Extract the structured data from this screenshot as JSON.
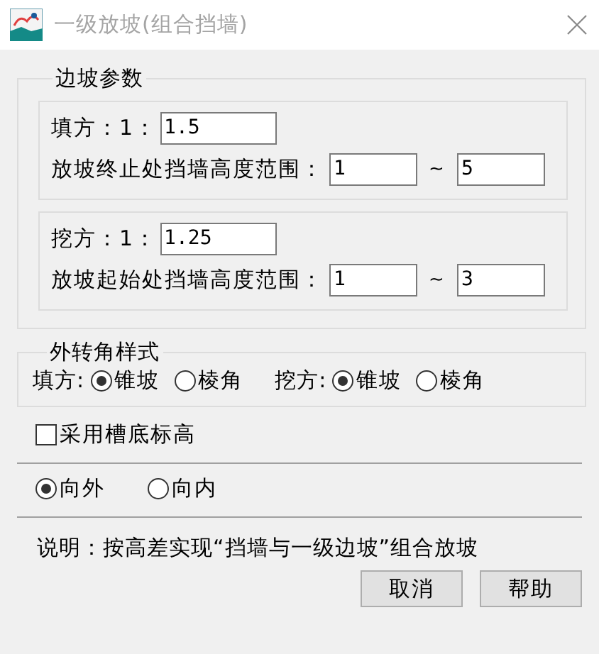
{
  "window": {
    "title": "一级放坡(组合挡墙)"
  },
  "slope_params": {
    "title": "边坡参数",
    "sections": [
      {
        "ratio_label": "填方：1：",
        "ratio": "1.5",
        "range_label": "放坡终止处挡墙高度范围：",
        "range_from": "1",
        "separator": "~",
        "range_to": "5"
      },
      {
        "ratio_label": "挖方：1：",
        "ratio": "1.25",
        "range_label": "放坡起始处挡墙高度范围：",
        "range_from": "1",
        "separator": "~",
        "range_to": "3"
      }
    ]
  },
  "corner_style": {
    "title": "外转角样式",
    "groups": [
      {
        "label": "填方:",
        "options": [
          {
            "label": "锥坡",
            "selected": true
          },
          {
            "label": "棱角",
            "selected": false
          }
        ]
      },
      {
        "label": "挖方:",
        "options": [
          {
            "label": "锥坡",
            "selected": true
          },
          {
            "label": "棱角",
            "selected": false
          }
        ]
      }
    ]
  },
  "trench_bottom": {
    "label": "采用槽底标高",
    "checked": false
  },
  "direction": {
    "options": [
      {
        "label": "向外",
        "selected": true
      },
      {
        "label": "向内",
        "selected": false
      }
    ]
  },
  "note": "说明：按高差实现“挡墙与一级边坡”组合放坡",
  "buttons": [
    "取消",
    "帮助"
  ]
}
